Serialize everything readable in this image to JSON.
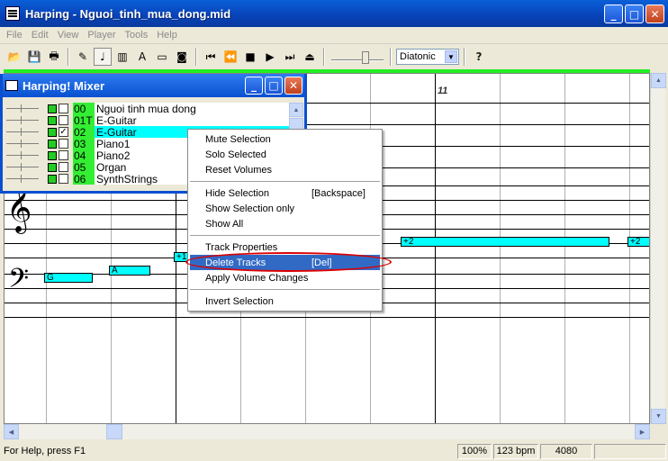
{
  "window": {
    "title": "Harping - Nguoi_tinh_mua_dong.mid"
  },
  "menu": [
    "File",
    "Edit",
    "View",
    "Player",
    "Tools",
    "Help"
  ],
  "toolbar": {
    "scale_select": "Diatonic",
    "help_glyph": "?"
  },
  "score": {
    "measure_label": "11",
    "clefs": {
      "treble": "𝄞",
      "bass": "𝄢"
    },
    "notes": [
      {
        "label": "G"
      },
      {
        "label": "A"
      },
      {
        "label": "+1"
      },
      {
        "label": "+2"
      },
      {
        "label": "+2"
      }
    ]
  },
  "mixer": {
    "title": "Harping! Mixer",
    "tracks": [
      {
        "num": "00",
        "name": "Nguoi tinh mua dong",
        "checked": false,
        "selected": false
      },
      {
        "num": "01T",
        "name": "E-Guitar",
        "checked": false,
        "selected": false
      },
      {
        "num": "02",
        "name": "E-Guitar",
        "checked": true,
        "selected": true
      },
      {
        "num": "03",
        "name": "Piano1",
        "checked": false,
        "selected": false
      },
      {
        "num": "04",
        "name": "Piano2",
        "checked": false,
        "selected": false
      },
      {
        "num": "05",
        "name": "Organ",
        "checked": false,
        "selected": false
      },
      {
        "num": "06",
        "name": "SynthStrings",
        "checked": false,
        "selected": false
      }
    ]
  },
  "context_menu": {
    "items": [
      {
        "label": "Mute Selection",
        "shortcut": ""
      },
      {
        "label": "Solo Selected",
        "shortcut": ""
      },
      {
        "label": "Reset Volumes",
        "shortcut": ""
      },
      {
        "label": "Hide Selection",
        "shortcut": "[Backspace]"
      },
      {
        "label": "Show Selection only",
        "shortcut": ""
      },
      {
        "label": "Show All",
        "shortcut": ""
      },
      {
        "label": "Track Properties",
        "shortcut": ""
      },
      {
        "label": "Delete Tracks",
        "shortcut": "[Del]"
      },
      {
        "label": "Apply Volume Changes",
        "shortcut": ""
      },
      {
        "label": "Invert Selection",
        "shortcut": ""
      }
    ],
    "highlighted": "Delete Tracks"
  },
  "status": {
    "help": "For Help, press F1",
    "zoom": "100%",
    "tempo": "123 bpm",
    "position": "4080"
  },
  "colors": {
    "titlebar": "#0a52d0",
    "note": "#00ffff",
    "highlight": "#316ac5",
    "track_num": "#33ee33",
    "annotation": "#dd0000"
  }
}
